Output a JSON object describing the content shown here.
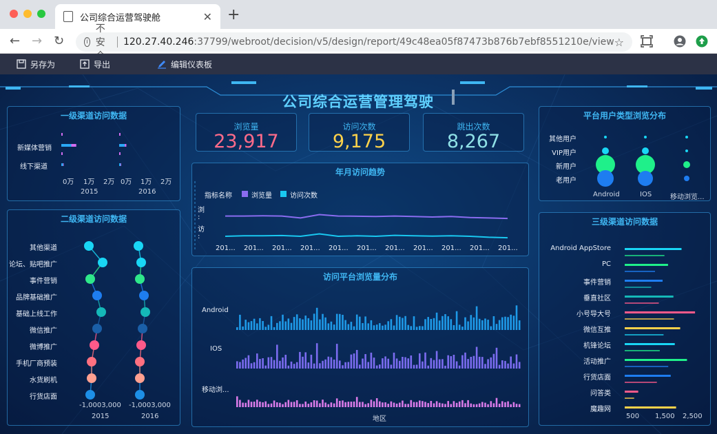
{
  "browser": {
    "tab_title": "公司综合运营驾驶舱",
    "tab_close": "✕",
    "new_tab": "+",
    "insecure": "不安全",
    "url_host": "120.27.40.246",
    "url_rest": ":37799/webroot/decision/v5/design/report/49c48ea05f87473b876b7ebf8551210e/view"
  },
  "app_toolbar": {
    "save_as": "另存为",
    "export": "导出",
    "edit": "编辑仪表板"
  },
  "dashboard_title": "公司综合运营管理驾驶",
  "colors": {
    "accent": "#3fb6f2",
    "pink": "#ff6b8a",
    "yellow": "#ffd24a",
    "teal": "#8fe0e6"
  },
  "kpis": [
    {
      "label": "浏览量",
      "value": "23,917",
      "color": "#ff6b8a"
    },
    {
      "label": "访问次数",
      "value": "9,175",
      "color": "#ffd24a"
    },
    {
      "label": "跳出次数",
      "value": "8,267",
      "color": "#8fe0e6"
    }
  ],
  "chart_data": [
    {
      "type": "bar",
      "title": "一级渠道访问数据",
      "categories": [
        "新媒体营销",
        "线下渠道"
      ],
      "facets": [
        "2015",
        "2016"
      ],
      "tick_labels": [
        "0万",
        "1万",
        "2万"
      ],
      "series": [
        {
          "facet": "2015",
          "category": "新媒体营销",
          "values": [
            5000,
            2500
          ]
        },
        {
          "facet": "2015",
          "category": "线下渠道",
          "values": [
            900,
            300
          ]
        },
        {
          "facet": "2016",
          "category": "新媒体营销",
          "values": [
            2800,
            800
          ]
        },
        {
          "facet": "2016",
          "category": "线下渠道",
          "values": [
            700,
            300
          ]
        }
      ]
    },
    {
      "type": "scatter",
      "title": "二级渠道访问数据",
      "categories": [
        "其他渠道",
        "论坛、贴吧推广",
        "事件营销",
        "品牌基础推广",
        "基础上线工作",
        "微信推广",
        "微博推广",
        "手机厂商预装",
        "水货刷机",
        "行货店面"
      ],
      "facets": [
        "2015",
        "2016"
      ],
      "facet_axis_label": "-1,0003,000",
      "point_colors": [
        "#19d6f5",
        "#19d6f5",
        "#2fe88a",
        "#1e7df0",
        "#15b8b8",
        "#1a5fa8",
        "#ff5a8a",
        "#ff7080",
        "#ffa090",
        "#1d8fe6"
      ]
    },
    {
      "type": "line",
      "title": "年月访问趋势",
      "legend_title": "指标名称",
      "legend": [
        "浏览量",
        "访问次数"
      ],
      "row_labels": [
        "浏\n:",
        "访\n:"
      ],
      "x_labels": [
        "201...",
        "201...",
        "201...",
        "201...",
        "201...",
        "201...",
        "201...",
        "201...",
        "201...",
        "201...",
        "201..."
      ],
      "series": [
        {
          "name": "浏览量",
          "color": "#8a6cf0",
          "values": [
            0.6,
            0.6,
            0.62,
            0.6,
            0.4,
            0.75,
            0.6,
            0.58,
            0.55,
            0.6,
            0.55,
            0.5,
            0.55,
            0.45,
            0.4,
            0.35
          ]
        },
        {
          "name": "访问次数",
          "color": "#19c8f0",
          "values": [
            0.5,
            0.55,
            0.55,
            0.58,
            0.5,
            0.75,
            0.5,
            0.55,
            0.5,
            0.6,
            0.55,
            0.52,
            0.55,
            0.5,
            0.4,
            0.35
          ]
        }
      ]
    },
    {
      "type": "bar",
      "title": "访问平台浏览量分布",
      "xlabel": "地区",
      "rows": [
        {
          "name": "Android",
          "color": "#1e9ae8"
        },
        {
          "name": "IOS",
          "color": "#7b6cf0"
        },
        {
          "name": "移动浏...",
          "color": "#d87ae8"
        }
      ]
    },
    {
      "type": "scatter",
      "title": "平台用户类型浏览分布",
      "rows": [
        "其他用户",
        "VIP用户",
        "新用户",
        "老用户"
      ],
      "columns": [
        "Android",
        "IOS",
        "移动浏览..."
      ],
      "row_colors": [
        "#19d6f5",
        "#19d6f5",
        "#1ff08a",
        "#1e7df0"
      ],
      "sizes": [
        [
          2,
          2,
          2
        ],
        [
          5,
          5,
          2
        ],
        [
          14,
          14,
          5
        ],
        [
          12,
          11,
          4
        ]
      ]
    },
    {
      "type": "bar",
      "title": "三级渠道访问数据",
      "categories": [
        "Android AppStore",
        "PC",
        "事件营销",
        "垂直社区",
        "小号导大号",
        "微信互推",
        "机锋论坛",
        "活动推广",
        "行货店面",
        "问答类",
        "魔趣网"
      ],
      "tick_labels": [
        "500",
        "1,500",
        "2,500"
      ],
      "values": [
        2100,
        1600,
        1400,
        1800,
        2600,
        2050,
        1850,
        2300,
        1700,
        500,
        1900
      ],
      "colors": [
        "#19d6f5",
        "#1ff08a",
        "#1e7df0",
        "#15b8b8",
        "#ff5a8a",
        "#ffd24a",
        "#19d6f5",
        "#1ff08a",
        "#1e7df0",
        "#ff5a8a",
        "#ffd24a"
      ]
    }
  ]
}
